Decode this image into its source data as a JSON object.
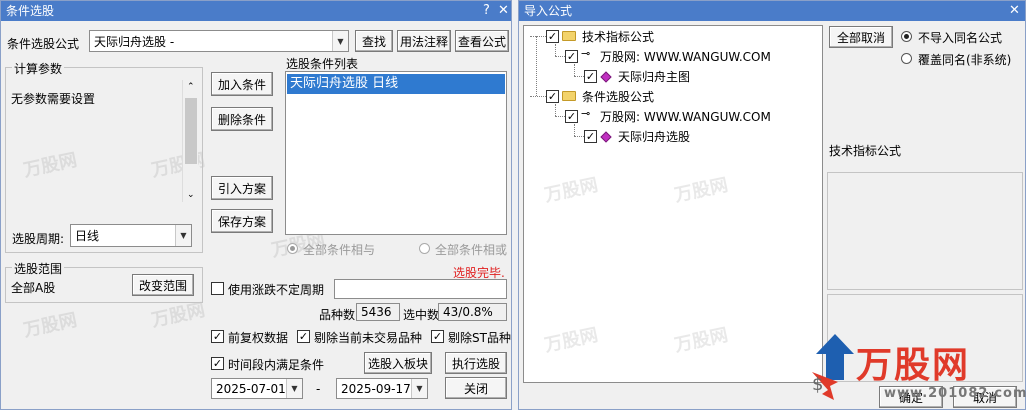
{
  "left": {
    "title": "条件选股",
    "formula_label": "条件选股公式",
    "formula_value": "天际归舟选股  -",
    "btn_find": "查找",
    "btn_usage": "用法注释",
    "btn_view": "查看公式",
    "calc_group": "计算参数",
    "calc_text": "无参数需要设置",
    "period_label": "选股周期:",
    "period_value": "日线",
    "btn_add": "加入条件",
    "btn_delete": "删除条件",
    "btn_import_plan": "引入方案",
    "btn_save_plan": "保存方案",
    "list_label": "选股条件列表",
    "list_items": [
      "天际归舟选股  日线"
    ],
    "radio_all_and": "全部条件相与",
    "radio_all_or": "全部条件相或",
    "status": "选股完毕.",
    "range_group": "选股范围",
    "range_value": "全部A股",
    "btn_change_range": "改变范围",
    "use_period_label": "使用涨跌不定周期",
    "count_label": "品种数",
    "count_value": "5436",
    "selected_label": "选中数",
    "selected_value": "43/0.8%",
    "chk_prior": "前复权数据",
    "chk_exclude_untraded": "剔除当前未交易品种",
    "chk_exclude_st": "剔除ST品种",
    "chk_period_satisfy": "时间段内满足条件",
    "btn_to_board": "选股入板块",
    "btn_execute": "执行选股",
    "date_from": "2025-07-01",
    "date_sep": "-",
    "date_to": "2025-09-17",
    "btn_close": "关闭",
    "watermark": "万股网"
  },
  "right": {
    "title": "导入公式",
    "tree": [
      {
        "label": "技术指标公式"
      },
      {
        "label": "万股网: WWW.WANGUW.COM"
      },
      {
        "label": "天际归舟主图"
      },
      {
        "label": "条件选股公式"
      },
      {
        "label": "万股网: WWW.WANGUW.COM"
      },
      {
        "label": "天际归舟选股"
      }
    ],
    "btn_cancel_all": "全部取消",
    "radio_no_import": "不导入同名公式",
    "radio_overwrite": "覆盖同名(非系统)",
    "section_label": "技术指标公式",
    "btn_ok": "确定",
    "btn_cancel": "取消",
    "logo_text": "万股网",
    "logo_url": "www.201082.com",
    "watermark": "万股网"
  },
  "colors": {
    "titlebar": "#4a7cc9",
    "selection": "#2f7ad0",
    "status_red": "#e02020",
    "logo_blue": "#1e5fb0",
    "logo_red": "#e03a2a"
  }
}
